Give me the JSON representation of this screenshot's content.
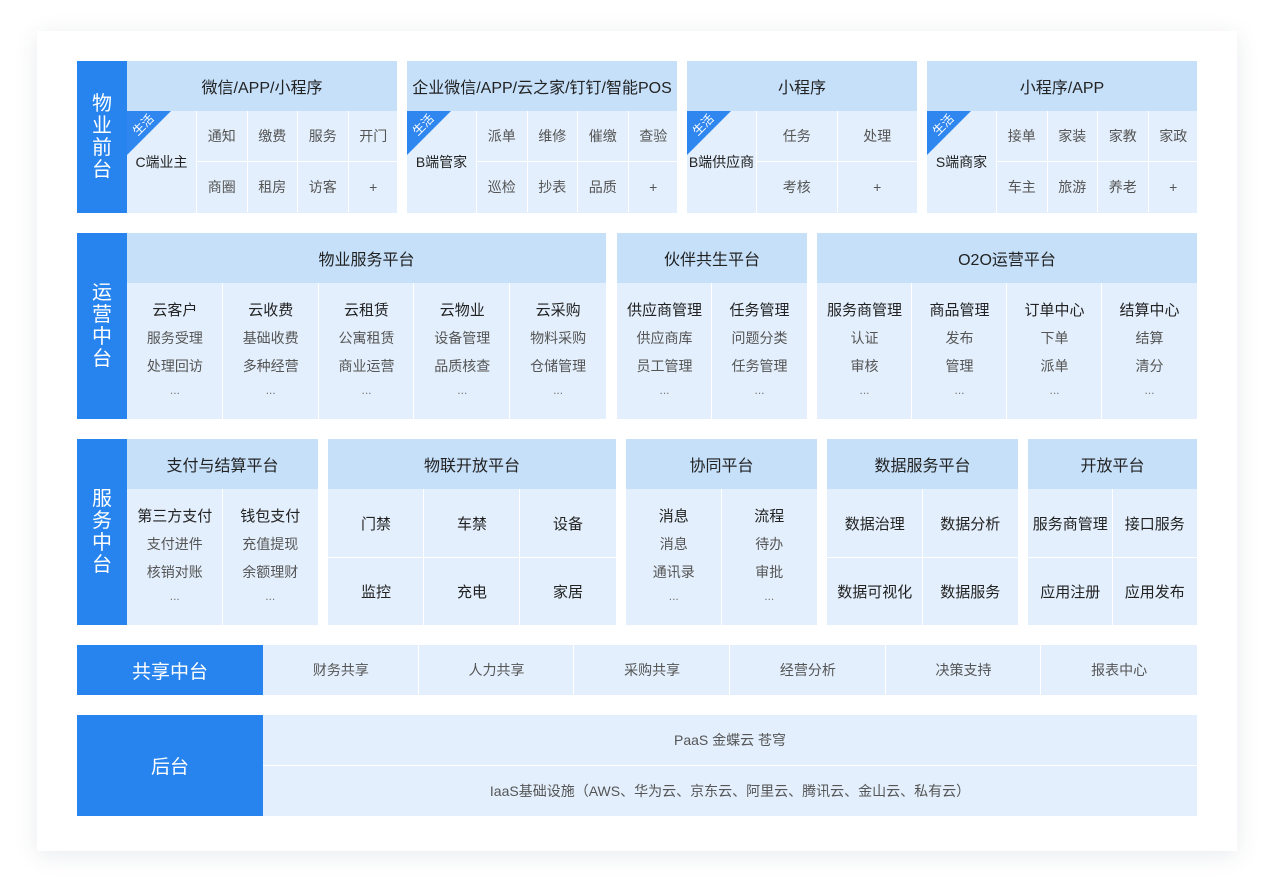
{
  "colors": {
    "side": "#2784ee",
    "header": "#c6e0fa",
    "panel": "#e3effc",
    "ribbon": "#2f86ee"
  },
  "front": {
    "label": "物业前台",
    "groups": [
      {
        "title": "微信/APP/小程序",
        "tag": "生活",
        "role": "C端业主",
        "items": [
          "通知",
          "缴费",
          "服务",
          "开门",
          "商圈",
          "租房",
          "访客",
          "+"
        ]
      },
      {
        "title": "企业微信/APP/云之家/钉钉/智能POS",
        "tag": "生活",
        "role": "B端管家",
        "items": [
          "派单",
          "维修",
          "催缴",
          "查验",
          "巡检",
          "抄表",
          "品质",
          "+"
        ]
      },
      {
        "title": "小程序",
        "tag": "生活",
        "role": "B端供应商",
        "items": [
          "任务",
          "处理",
          "考核",
          "+"
        ]
      },
      {
        "title": "小程序/APP",
        "tag": "生活",
        "role": "S端商家",
        "items": [
          "接单",
          "家装",
          "家教",
          "家政",
          "车主",
          "旅游",
          "养老",
          "+"
        ]
      }
    ]
  },
  "ops": {
    "label": "运营中台",
    "groups": [
      {
        "title": "物业服务平台",
        "cols": [
          {
            "title": "云客户",
            "lines": [
              "服务受理",
              "处理回访",
              "..."
            ]
          },
          {
            "title": "云收费",
            "lines": [
              "基础收费",
              "多种经营",
              "..."
            ]
          },
          {
            "title": "云租赁",
            "lines": [
              "公寓租赁",
              "商业运营",
              "..."
            ]
          },
          {
            "title": "云物业",
            "lines": [
              "设备管理",
              "品质核查",
              "..."
            ]
          },
          {
            "title": "云采购",
            "lines": [
              "物料采购",
              "仓储管理",
              "..."
            ]
          }
        ]
      },
      {
        "title": "伙伴共生平台",
        "cols": [
          {
            "title": "供应商管理",
            "lines": [
              "供应商库",
              "员工管理",
              "..."
            ]
          },
          {
            "title": "任务管理",
            "lines": [
              "问题分类",
              "任务管理",
              "..."
            ]
          }
        ]
      },
      {
        "title": "O2O运营平台",
        "cols": [
          {
            "title": "服务商管理",
            "lines": [
              "认证",
              "审核",
              "..."
            ]
          },
          {
            "title": "商品管理",
            "lines": [
              "发布",
              "管理",
              "..."
            ]
          },
          {
            "title": "订单中心",
            "lines": [
              "下单",
              "派单",
              "..."
            ]
          },
          {
            "title": "结算中心",
            "lines": [
              "结算",
              "清分",
              "..."
            ]
          }
        ]
      }
    ]
  },
  "service": {
    "label": "服务中台",
    "pay": {
      "title": "支付与结算平台",
      "cols": [
        {
          "title": "第三方支付",
          "lines": [
            "支付进件",
            "核销对账",
            "..."
          ]
        },
        {
          "title": "钱包支付",
          "lines": [
            "充值提现",
            "余额理财",
            "..."
          ]
        }
      ]
    },
    "iot": {
      "title": "物联开放平台",
      "items": [
        "门禁",
        "车禁",
        "设备",
        "监控",
        "充电",
        "家居"
      ]
    },
    "collab": {
      "title": "协同平台",
      "cols": [
        {
          "title": "消息",
          "lines": [
            "消息",
            "通讯录",
            "..."
          ]
        },
        {
          "title": "流程",
          "lines": [
            "待办",
            "审批",
            "..."
          ]
        }
      ]
    },
    "data": {
      "title": "数据服务平台",
      "items": [
        "数据治理",
        "数据分析",
        "数据可视化",
        "数据服务"
      ]
    },
    "open": {
      "title": "开放平台",
      "items": [
        "服务商管理",
        "接口服务",
        "应用注册",
        "应用发布"
      ]
    }
  },
  "shared": {
    "label": "共享中台",
    "items": [
      "财务共享",
      "人力共享",
      "采购共享",
      "经营分析",
      "决策支持",
      "报表中心"
    ]
  },
  "backend": {
    "label": "后台",
    "paas": "PaaS 金蝶云 苍穹",
    "iaas": "IaaS基础设施（AWS、华为云、京东云、阿里云、腾讯云、金山云、私有云）"
  }
}
